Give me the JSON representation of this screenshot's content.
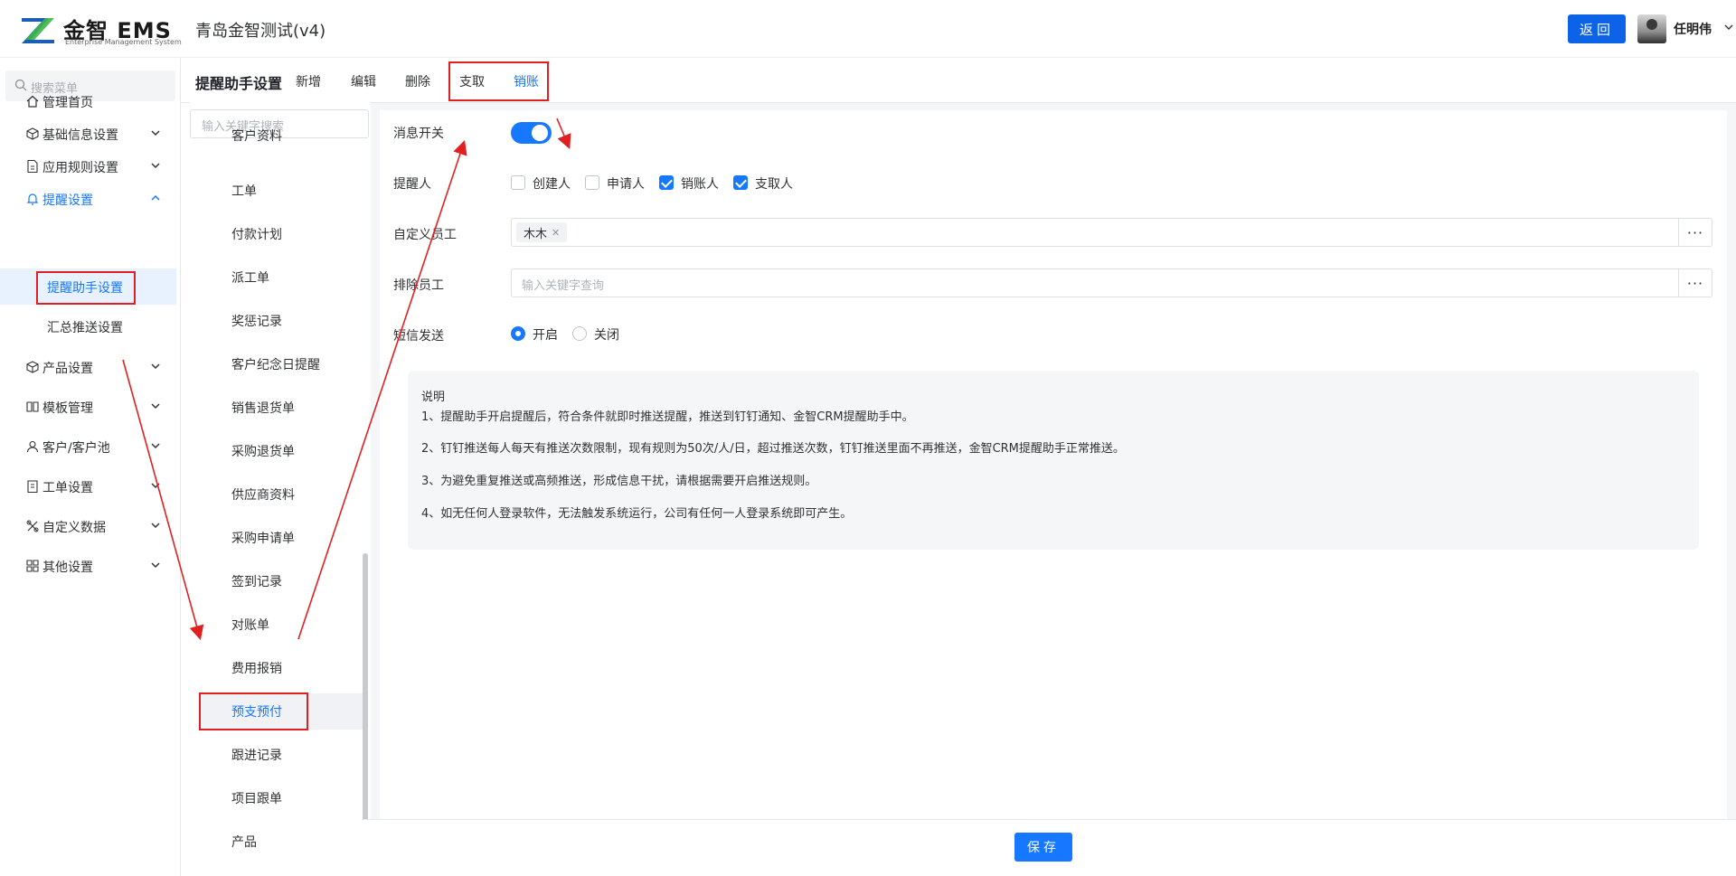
{
  "header": {
    "logo_name": "金智 EMS",
    "logo_sub": "Enterprise Management System",
    "app_title": "青岛金智测试(v4)",
    "back_label": "返回",
    "user_name": "任明伟"
  },
  "sidebar": {
    "search_placeholder": "搜索菜单",
    "items": [
      {
        "label": "管理首页",
        "icon": "home-icon"
      },
      {
        "label": "基础信息设置",
        "icon": "cube-icon"
      },
      {
        "label": "应用规则设置",
        "icon": "document-icon"
      },
      {
        "label": "提醒设置",
        "icon": "bell-icon"
      },
      {
        "label": "产品设置",
        "icon": "cube-icon"
      },
      {
        "label": "模板管理",
        "icon": "template-icon"
      },
      {
        "label": "客户/客户池",
        "icon": "user-icon"
      },
      {
        "label": "工单设置",
        "icon": "clipboard-icon"
      },
      {
        "label": "自定义数据",
        "icon": "tools-icon"
      },
      {
        "label": "其他设置",
        "icon": "grid-icon"
      }
    ],
    "sub_items": [
      "提醒助手设置",
      "汇总推送设置"
    ]
  },
  "tabs": {
    "page_title": "提醒助手设置",
    "items": [
      "新增",
      "编辑",
      "删除",
      "支取",
      "销账"
    ]
  },
  "mid_list": {
    "search_placeholder": "输入关键字搜索",
    "items": [
      "客户资料",
      "工单",
      "付款计划",
      "派工单",
      "奖惩记录",
      "客户纪念日提醒",
      "销售退货单",
      "采购退货单",
      "供应商资料",
      "采购申请单",
      "签到记录",
      "对账单",
      "费用报销",
      "预支预付",
      "跟进记录",
      "项目跟单",
      "产品"
    ],
    "selected": "预支预付"
  },
  "form": {
    "switch_label": "消息开关",
    "switch_on": true,
    "reminder_label": "提醒人",
    "reminders": [
      {
        "label": "创建人",
        "checked": false
      },
      {
        "label": "申请人",
        "checked": false
      },
      {
        "label": "销账人",
        "checked": true
      },
      {
        "label": "支取人",
        "checked": true
      }
    ],
    "custom_label": "自定义员工",
    "custom_tag": "木木",
    "exclude_label": "排除员工",
    "exclude_placeholder": "输入关键字查询",
    "sms_label": "短信发送",
    "sms_on": "开启",
    "sms_off": "关闭",
    "more": "···"
  },
  "note": {
    "title": "说明",
    "lines": [
      "1、提醒助手开启提醒后，符合条件就即时推送提醒，推送到钉钉通知、金智CRM提醒助手中。",
      "2、钉钉推送每人每天有推送次数限制，现有规则为50次/人/日，超过推送次数，钉钉推送里面不再推送，金智CRM提醒助手正常推送。",
      "3、为避免重复推送或高频推送，形成信息干扰，请根据需要开启推送规则。",
      "4、如无任何人登录软件，无法触发系统运行，公司有任何一人登录系统即可产生。"
    ]
  },
  "footer": {
    "save_label": "保存"
  },
  "colors": {
    "accent": "#1677ff",
    "annotation": "#e02020"
  }
}
